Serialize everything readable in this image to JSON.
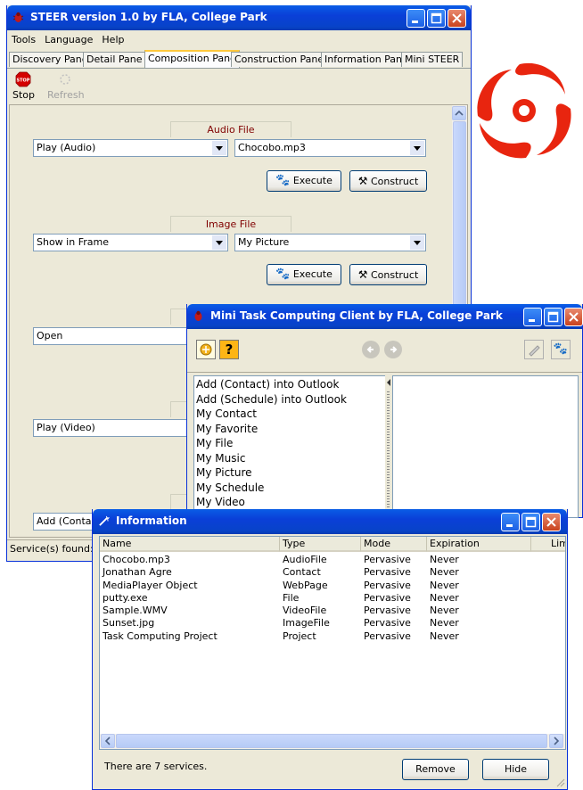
{
  "steer": {
    "title": "STEER version 1.0 by FLA, College Park",
    "menu": [
      "Tools",
      "Language",
      "Help"
    ],
    "tabs": [
      "Discovery Pane",
      "Detail Pane",
      "Composition Pane",
      "Construction Pane",
      "Information Pane",
      "Mini STEER"
    ],
    "active_tab": "Composition Pane",
    "toolbar": {
      "stop_label": "Stop",
      "refresh_label": "Refresh"
    },
    "groups": [
      {
        "label": "Audio File",
        "action": "Play (Audio)",
        "target": "Chocobo.mp3"
      },
      {
        "label": "Image File",
        "action": "Show in Frame",
        "target": "My Picture"
      },
      {
        "action": "Open"
      },
      {
        "action": "Play (Video)"
      },
      {
        "action": "Add (Contac"
      }
    ],
    "execute_label": "Execute",
    "construct_label": "Construct",
    "status": "Service(s) found:"
  },
  "mini": {
    "title": "Mini Task Computing Client by FLA, College Park",
    "services": [
      "Add (Contact) into Outlook",
      "Add (Schedule) into Outlook",
      "My Contact",
      "My Favorite",
      "My File",
      "My Music",
      "My Picture",
      "My Schedule",
      "My Video"
    ]
  },
  "info": {
    "title": "Information",
    "columns": [
      "Name",
      "Type",
      "Mode",
      "Expiration",
      "Limit"
    ],
    "rows": [
      [
        "Chocobo.mp3",
        "AudioFile",
        "Pervasive",
        "Never"
      ],
      [
        "Jonathan Agre",
        "Contact",
        "Pervasive",
        "Never"
      ],
      [
        "MediaPlayer Object",
        "WebPage",
        "Pervasive",
        "Never"
      ],
      [
        "putty.exe",
        "File",
        "Pervasive",
        "Never"
      ],
      [
        "Sample.WMV",
        "VideoFile",
        "Pervasive",
        "Never"
      ],
      [
        "Sunset.jpg",
        "ImageFile",
        "Pervasive",
        "Never"
      ],
      [
        "Task Computing Project",
        "Project",
        "Pervasive",
        "Never"
      ]
    ],
    "status": "There are 7 services.",
    "remove_label": "Remove",
    "hide_label": "Hide"
  },
  "colors": {
    "title_blue": "#0a3fd8",
    "group_label": "#800000",
    "logo_red": "#e8250f"
  }
}
